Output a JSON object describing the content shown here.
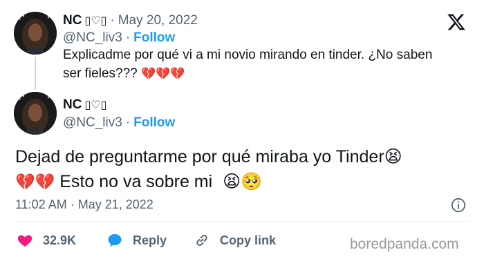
{
  "reply_tweet": {
    "name": "NC",
    "name_extra": "▯♡▯",
    "date": "May 20, 2022",
    "handle": "@NC_liv3",
    "follow_label": "Follow",
    "text": "Explicadme por qué vi a mi novio mirando en tinder. ¿No saben ser fieles???",
    "emojis": "💔💔💔"
  },
  "main_tweet": {
    "name": "NC",
    "name_extra": "▯♡▯",
    "handle": "@NC_liv3",
    "follow_label": "Follow",
    "text_part1": "Dejad de preguntarme por qué miraba yo Tinder",
    "emoji_tired": "😫",
    "emoji_broken": "💔💔",
    "text_part2": "Esto no va sobre mi",
    "emoji_end": "😫🥺",
    "time": "11:02 AM",
    "date": "May 21, 2022",
    "likes": "32.9K",
    "reply_label": "Reply",
    "copy_label": "Copy link"
  },
  "colors": {
    "accent": "#1d9bf0",
    "like": "#f91880",
    "muted": "#536471",
    "text": "#0f1419"
  },
  "icons": [
    "x-logo-icon",
    "info-icon",
    "heart-icon",
    "reply-bubble-icon",
    "link-icon"
  ],
  "watermark": "boredpanda.com"
}
